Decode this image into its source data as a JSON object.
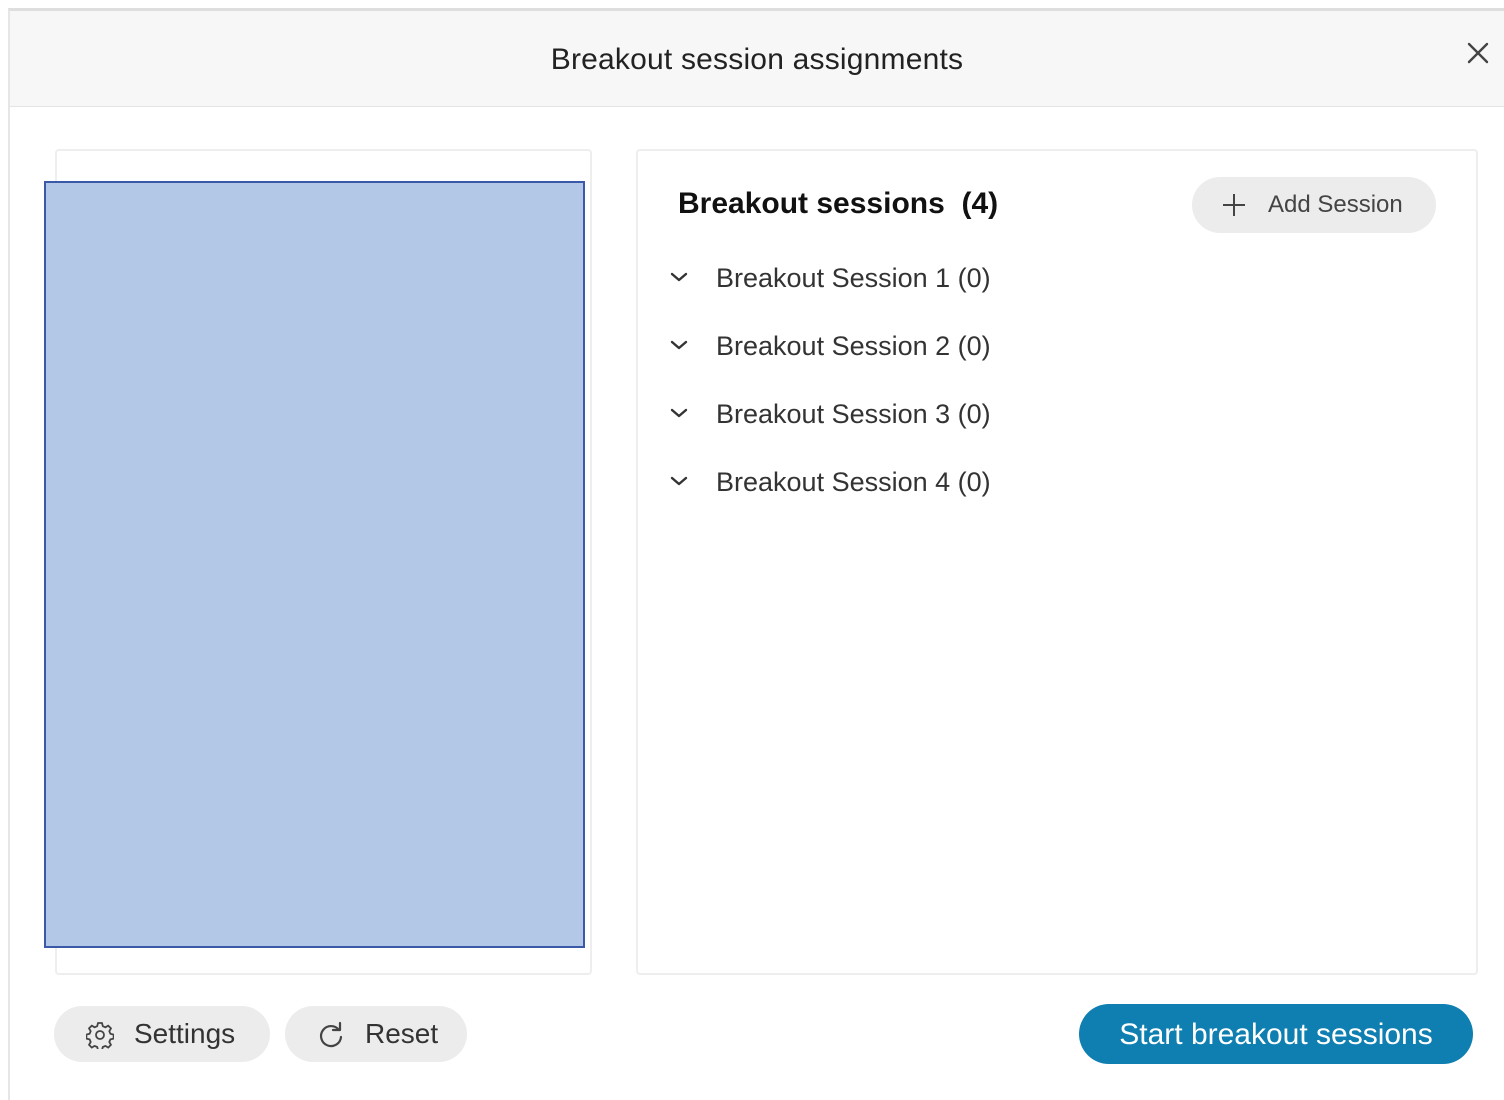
{
  "dialog": {
    "title": "Breakout session assignments"
  },
  "sessions_panel": {
    "heading": "Breakout sessions",
    "count": "(4)",
    "add_label": "Add Session",
    "sessions": [
      {
        "label": "Breakout Session 1 (0)"
      },
      {
        "label": "Breakout Session 2 (0)"
      },
      {
        "label": "Breakout Session 3 (0)"
      },
      {
        "label": "Breakout Session 4 (0)"
      }
    ]
  },
  "footer": {
    "settings_label": "Settings",
    "reset_label": "Reset",
    "start_label": "Start breakout sessions"
  },
  "icons": {
    "close": "close-icon",
    "add": "plus-icon",
    "expand": "chevron-down-icon",
    "settings": "gear-icon",
    "reset": "refresh-icon"
  },
  "colors": {
    "primary": "#0e7fb0",
    "placeholder_fill": "#b3c7e6",
    "placeholder_border": "#3a5aa8",
    "pill_bg": "#ececec"
  }
}
